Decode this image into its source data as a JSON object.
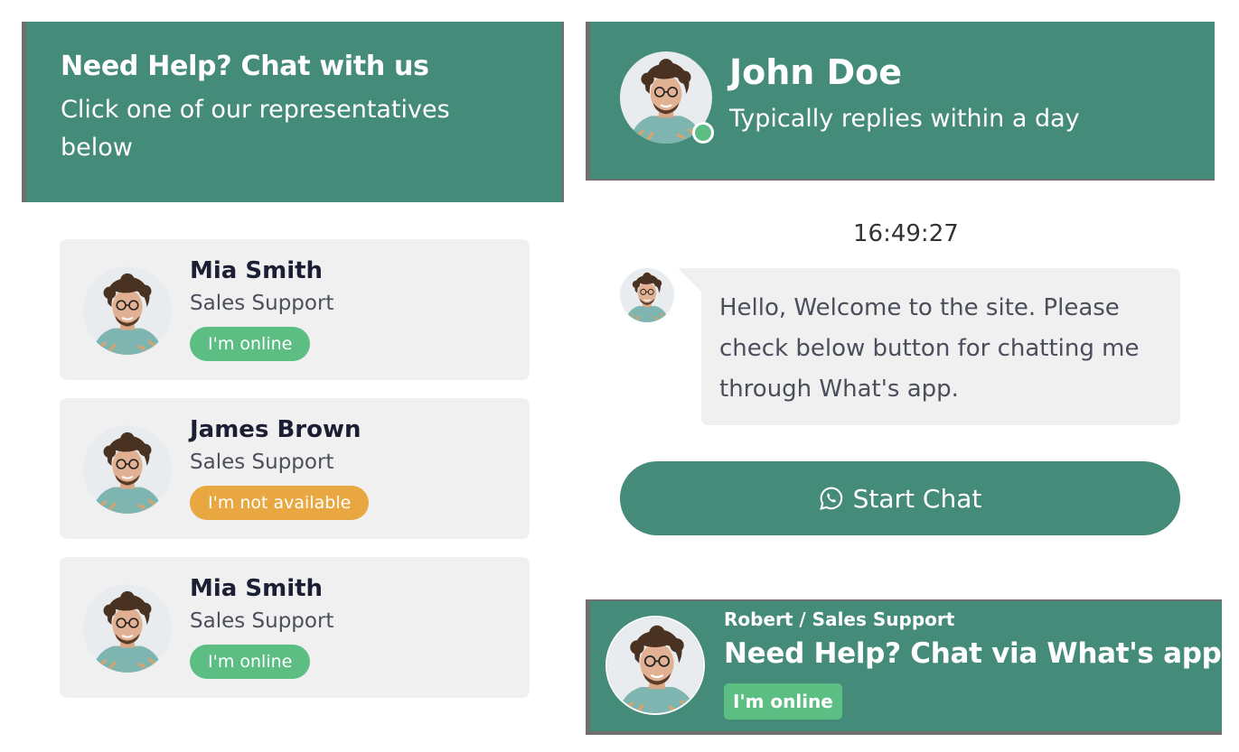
{
  "left_header": {
    "title": "Need Help? Chat with us",
    "subtitle": "Click one of our representatives below"
  },
  "agents": [
    {
      "name": "Mia Smith",
      "role": "Sales Support",
      "status": "I'm online",
      "status_type": "online"
    },
    {
      "name": "James Brown",
      "role": "Sales Support",
      "status": "I'm not available",
      "status_type": "away"
    },
    {
      "name": "Mia Smith",
      "role": "Sales Support",
      "status": "I'm online",
      "status_type": "online"
    }
  ],
  "chat": {
    "agent_name": "John Doe",
    "reply_time": "Typically replies within a day",
    "timestamp": "16:49:27",
    "message": "Hello, Welcome to the site. Please check below button for chatting me through What's app.",
    "start_button": "Start Chat"
  },
  "banner": {
    "top_line": "Robert / Sales Support",
    "title": "Need Help? Chat via What's app",
    "status": "I'm online"
  },
  "colors": {
    "brand": "#458b7a",
    "online": "#5dbe84",
    "away": "#e8a740",
    "card_bg": "#f0f0f1"
  },
  "icons": [
    "whatsapp-icon",
    "avatar",
    "online-status-dot"
  ]
}
